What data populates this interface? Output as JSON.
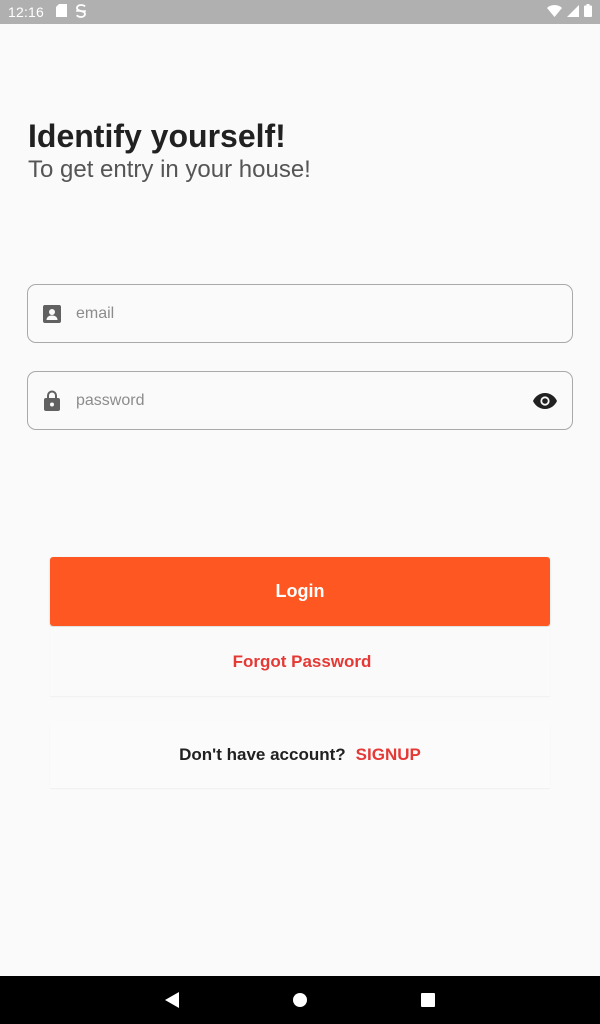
{
  "status_bar": {
    "time": "12:16",
    "left_icons": [
      "sd-card-icon",
      "s-app-icon"
    ],
    "right_icons": [
      "wifi-icon",
      "signal-icon",
      "battery-icon"
    ]
  },
  "header": {
    "title": "Identify yourself!",
    "subtitle": "To get entry in your house!"
  },
  "form": {
    "email": {
      "placeholder": "email",
      "value": "",
      "icon": "account-box-icon"
    },
    "password": {
      "placeholder": "password",
      "value": "",
      "icon": "lock-icon",
      "toggle_icon": "eye-icon"
    }
  },
  "actions": {
    "login_label": "Login",
    "forgot_label": "Forgot Password",
    "signup_prompt": "Don't have account?",
    "signup_label": "SIGNUP"
  },
  "colors": {
    "accent": "#ff5722",
    "link": "#e53935",
    "title": "#212121",
    "subtitle": "#555555"
  },
  "nav_bar": {
    "buttons": [
      "back-icon",
      "home-icon",
      "recents-icon"
    ]
  }
}
